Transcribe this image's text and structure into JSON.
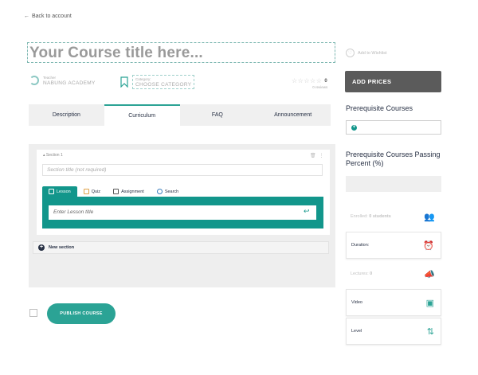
{
  "back_link": "Back to account",
  "course_title_placeholder": "Your Course title here...",
  "wishlist_label": "Add to Wishlist",
  "teacher": {
    "label": "Teacher",
    "name": "NABUNG ACADEMY"
  },
  "category": {
    "label": "Category:",
    "value": "CHOOSE CATEGORY"
  },
  "rating": {
    "stars": "☆☆☆☆☆",
    "value": "0",
    "reviews": "0 reviews"
  },
  "tabs": [
    {
      "label": "Description",
      "active": false
    },
    {
      "label": "Curriculum",
      "active": true
    },
    {
      "label": "FAQ",
      "active": false
    },
    {
      "label": "Announcement",
      "active": false
    }
  ],
  "section": {
    "header": "Section 1",
    "title_placeholder": "Section title (not required)",
    "types": [
      {
        "label": "Lesson",
        "icon": "document-icon"
      },
      {
        "label": "Quiz",
        "icon": "quiz-icon"
      },
      {
        "label": "Assignment",
        "icon": "assignment-icon"
      },
      {
        "label": "Search",
        "icon": "search-icon"
      }
    ],
    "lesson_placeholder": "Enter Lesson title"
  },
  "new_section_label": "New section",
  "publish_label": "PUBLISH COURSE",
  "sidebar": {
    "add_prices": "ADD PRICES",
    "prereq_courses_label": "Prerequisite Courses",
    "prereq_percent_label": "Prerequisite Courses Passing Percent (%)",
    "enrolled_label": "Enrolled:",
    "enrolled_value": "0 students",
    "duration_label": "Duration:",
    "lectures_label": "Lectures:",
    "lectures_value": "0",
    "video_label": "Video",
    "level_label": "Level"
  },
  "colors": {
    "accent": "#2ba395",
    "dark_teal": "#12968b",
    "prices_bg": "#5b5b5b"
  }
}
